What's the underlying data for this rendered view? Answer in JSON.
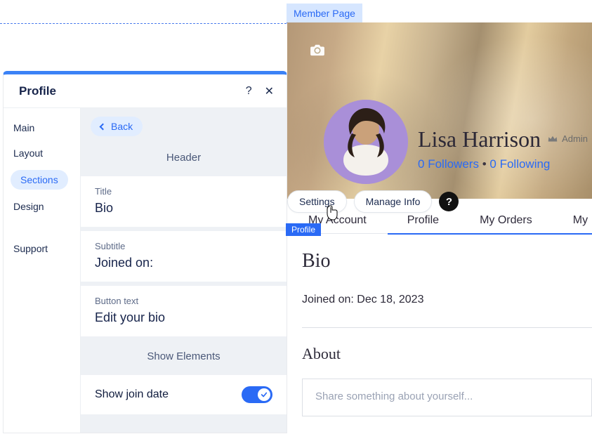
{
  "editor": {
    "member_page_tag": "Member Page",
    "profile_chip": "Profile"
  },
  "panel": {
    "title": "Profile",
    "side": {
      "items": [
        "Main",
        "Layout",
        "Sections",
        "Design"
      ],
      "support": "Support",
      "active_index": 2
    },
    "back_label": "Back",
    "header_label": "Header",
    "fields": {
      "title": {
        "label": "Title",
        "value": "Bio"
      },
      "subtitle": {
        "label": "Subtitle",
        "value": "Joined on:"
      },
      "button_text": {
        "label": "Button text",
        "value": "Edit your bio"
      }
    },
    "show_elements_label": "Show Elements",
    "toggles": {
      "show_join_date": {
        "label": "Show join date",
        "on": true
      }
    }
  },
  "preview": {
    "name": "Lisa Harrison",
    "admin_label": "Admin",
    "followers_count": 0,
    "followers_label": "Followers",
    "following_count": 0,
    "following_label": "Following",
    "actions": {
      "settings": "Settings",
      "manage_info": "Manage Info"
    },
    "tabs": [
      "My Account",
      "Profile",
      "My Orders",
      "My"
    ],
    "active_tab_index": 1,
    "bio_heading": "Bio",
    "joined_prefix": "Joined on: ",
    "joined_date": "Dec 18, 2023",
    "about_heading": "About",
    "about_placeholder": "Share something about yourself..."
  }
}
